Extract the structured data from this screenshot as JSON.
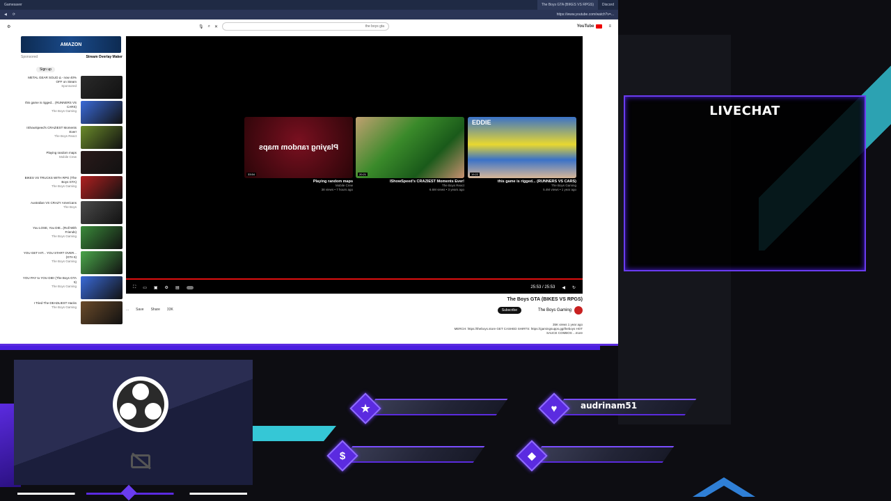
{
  "browser": {
    "tabs": [
      {
        "label": "Gamesaver"
      },
      {
        "label": "The Boys GTA (BIKES VS RPGS)"
      },
      {
        "label": "Discord"
      }
    ],
    "url": "https://www.youtube.com/watch?v=...",
    "search_placeholder": "the boys gta",
    "brand": "YouTube"
  },
  "sidebar": {
    "ad_banner": "AMAZON",
    "ad_title": "Stream Overlay Maker",
    "ad_sponsor": "Sponsored",
    "sign_up": "Sign up",
    "videos": [
      {
        "title": "METAL GEAR SOLID Δ - now 40% OFF on Steam",
        "channel": "Sponsored",
        "color": "#2a2a2a"
      },
      {
        "title": "this game is rigged... (RUNNERS VS CARS)",
        "channel": "The Boys Gaming",
        "color": "#3a6ad8"
      },
      {
        "title": "IShowSpeed's CRAZIEST Moments Ever!",
        "channel": "The Boys React",
        "color": "#6a8a2a"
      },
      {
        "title": "Playing random maps",
        "channel": "Mobile Crew",
        "color": "#2a1a1a"
      },
      {
        "title": "BIKES VS TRUCKS WITH RPG (The Boys GTA)",
        "channel": "The Boys Gaming",
        "color": "#b02020"
      },
      {
        "title": "Australian VS CRAZY Americans",
        "channel": "The Boys",
        "color": "#4a4a4a"
      },
      {
        "title": "You LOSE, You DIE...(Roll With Friends)",
        "channel": "The Boys Gaming",
        "color": "#3a8a3a"
      },
      {
        "title": "YOU GET HIT... YOU START OVER... (GTA 5)",
        "channel": "The Boys Gaming",
        "color": "#4aa64a"
      },
      {
        "title": "YOU PAY to YOU DIE! (The Boys GTA 5)",
        "channel": "The Boys Gaming",
        "color": "#3a6ad8"
      },
      {
        "title": "I Tried The DEADLIEST Hacks",
        "channel": "The Boys Gaming",
        "color": "#6a4a2a"
      }
    ]
  },
  "player": {
    "end_cards": [
      {
        "title": "Playing random maps",
        "channel": "Mobile Crew",
        "meta": "38 views • 7 hours ago",
        "duration": "33:54",
        "overlay": "Playing random maps",
        "color": "#3a0a12"
      },
      {
        "title": "IShowSpeed's CRAZIEST Moments Ever!",
        "channel": "The Boys React",
        "meta": "6.6M views • 3 years ago",
        "duration": "20:21",
        "overlay": "",
        "color": "#2f6a1a"
      },
      {
        "title": "this game is rigged... (RUNNERS VS CARS)",
        "channel": "The Boys Gaming",
        "meta": "5.4M views • 1 year ago",
        "duration": "19:22",
        "overlay": "EDDIE",
        "color": "#3a72c8"
      }
    ],
    "time": "25:53 / 25:53"
  },
  "video": {
    "title": "The Boys GTA (BIKES VS RPGS)",
    "channel": "The Boys Gaming",
    "subscribe": "Subscribe",
    "views": "35K views  1 year ago",
    "description": "MERCH: https://theboys.store  GET CASHED SHIRTS: https://gamingsupps.gg/theboys  HOT SAUCE COMBOS ...more",
    "actions": [
      "33K",
      "Share",
      "Save",
      "..."
    ]
  },
  "overlay": {
    "livechat": "LIVECHAT",
    "alerts": [
      {
        "icon": "★",
        "label": ""
      },
      {
        "icon": "♥",
        "label": "audrinam51"
      },
      {
        "icon": "$",
        "label": ""
      },
      {
        "icon": "◆",
        "label": ""
      }
    ],
    "colors": {
      "accent": "#6a3cf0",
      "cyan": "#35c7d6"
    }
  }
}
